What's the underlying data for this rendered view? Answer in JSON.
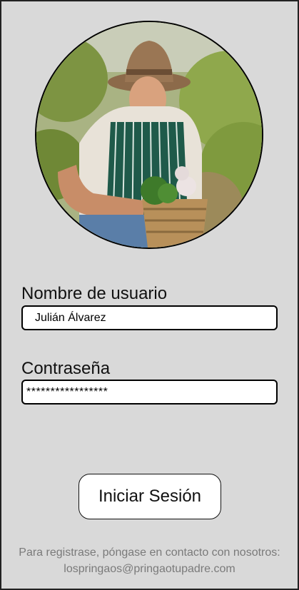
{
  "login": {
    "username_label": "Nombre de usuario",
    "username_value": "Julián Álvarez",
    "password_label": "Contraseña",
    "password_value": "*****************",
    "submit_label": "Iniciar Sesión"
  },
  "footer": {
    "line1": "Para registrase, póngase en contacto con nosotros:",
    "line2": "lospringaos@pringaotupadre.com"
  },
  "colors": {
    "background": "#d9d9d9",
    "field_bg": "#ffffff",
    "border": "#000000",
    "footer_text": "#7a7a7a"
  }
}
